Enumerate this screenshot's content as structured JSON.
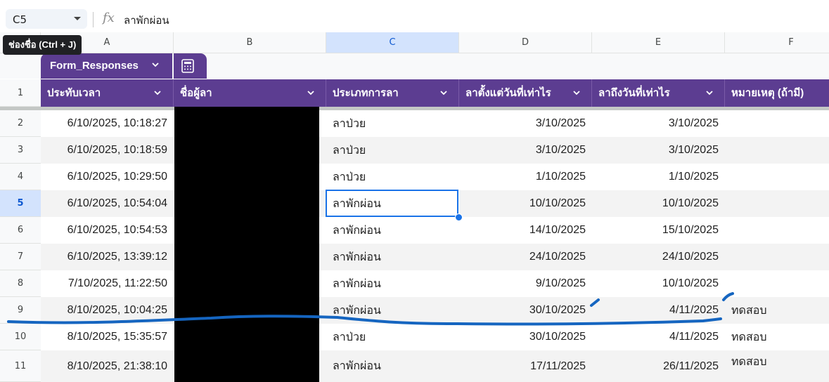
{
  "formula_bar": {
    "cell_ref": "C5",
    "fx_label": "fx",
    "value": "ลาพักผ่อน"
  },
  "tooltip": "ช่องชื่อ (Ctrl + J)",
  "columns": [
    "A",
    "B",
    "C",
    "D",
    "E",
    "F"
  ],
  "selected_column": "C",
  "table": {
    "name": "Form_Responses",
    "headers": [
      "ประทับเวลา",
      "ชื่อผู้ลา",
      "ประเภทการลา",
      "ลาตั้งแต่วันที่เท่าไร",
      "ลาถึงวันที่เท่าไร",
      "หมายเหตุ (ถ้ามี)"
    ],
    "header_row_number": "1",
    "rows": [
      {
        "num": "2",
        "timestamp": "6/10/2025, 10:18:27",
        "name": "",
        "type": "ลาป่วย",
        "from": "3/10/2025",
        "to": "3/10/2025",
        "note": ""
      },
      {
        "num": "3",
        "timestamp": "6/10/2025, 10:18:59",
        "name": "",
        "type": "ลาป่วย",
        "from": "3/10/2025",
        "to": "3/10/2025",
        "note": ""
      },
      {
        "num": "4",
        "timestamp": "6/10/2025, 10:29:50",
        "name": "",
        "type": "ลาป่วย",
        "from": "1/10/2025",
        "to": "1/10/2025",
        "note": ""
      },
      {
        "num": "5",
        "timestamp": "6/10/2025, 10:54:04",
        "name": "",
        "type": "ลาพักผ่อน",
        "from": "10/10/2025",
        "to": "10/10/2025",
        "note": ""
      },
      {
        "num": "6",
        "timestamp": "6/10/2025, 10:54:53",
        "name": "",
        "type": "ลาพักผ่อน",
        "from": "14/10/2025",
        "to": "15/10/2025",
        "note": ""
      },
      {
        "num": "7",
        "timestamp": "6/10/2025, 13:39:12",
        "name": "",
        "type": "ลาพักผ่อน",
        "from": "24/10/2025",
        "to": "24/10/2025",
        "note": ""
      },
      {
        "num": "8",
        "timestamp": "7/10/2025, 11:22:50",
        "name": "",
        "type": "ลาพักผ่อน",
        "from": "9/10/2025",
        "to": "10/10/2025",
        "note": ""
      },
      {
        "num": "9",
        "timestamp": "8/10/2025, 10:04:25",
        "name": "",
        "type": "ลาพักผ่อน",
        "from": "30/10/2025",
        "to": "4/11/2025",
        "note": "ทดสอบ"
      },
      {
        "num": "10",
        "timestamp": "8/10/2025, 15:35:57",
        "name": "",
        "type": "ลาป่วย",
        "from": "30/10/2025",
        "to": "4/11/2025",
        "note": "ทดสอบ"
      },
      {
        "num": "11",
        "timestamp": "8/10/2025, 21:38:10",
        "name": "",
        "type": "ลาพักผ่อน",
        "from": "17/11/2025",
        "to": "26/11/2025",
        "note": "ทดสอบ"
      }
    ]
  },
  "selected_row": "5",
  "colors": {
    "table_header": "#5c3d91",
    "selection": "#1a73e8",
    "ink": "#1565c0"
  }
}
